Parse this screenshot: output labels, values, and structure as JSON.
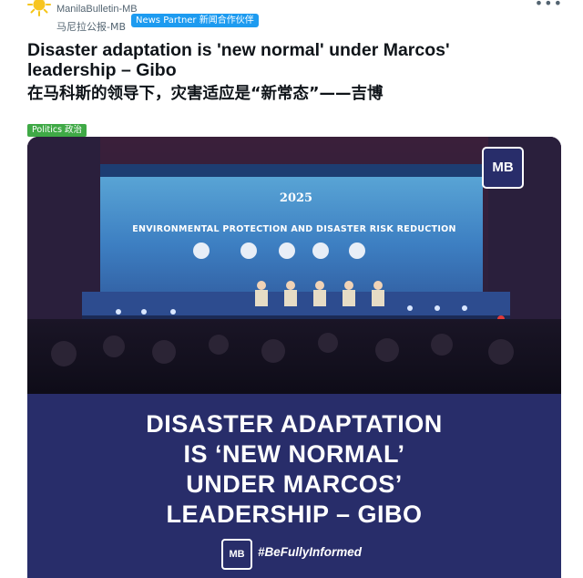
{
  "header": {
    "account_name": "ManilaBulletin-MB",
    "account_sub": "马尼拉公报-MB",
    "partner_badge": "News Partner 新闻合作伙伴",
    "more_icon": "more-horizontal-icon",
    "avatar_icon": "sun-avatar-icon"
  },
  "article": {
    "title_en": "Disaster adaptation is 'new normal' under Marcos' leadership – Gibo",
    "title_zh": "在马科斯的领导下，灾害适应是“新常态”——吉博",
    "category": "Politics 政治"
  },
  "image": {
    "stage_title": "ENVIRONMENTAL PROTECTION AND DISASTER RISK REDUCTION",
    "event_year": "2025",
    "logo_text": "MB",
    "headline_lines": [
      "DISASTER ADAPTATION",
      "IS ‘NEW NORMAL’",
      "UNDER MARCOS’",
      "LEADERSHIP – GIBO"
    ],
    "footer_logo": "MB",
    "hashtag": "#BeFullyInformed"
  },
  "colors": {
    "partner_badge": "#1d9bf0",
    "category_tag": "#3fa946",
    "panel_blue": "#282d6a",
    "text_secondary": "#536471"
  }
}
